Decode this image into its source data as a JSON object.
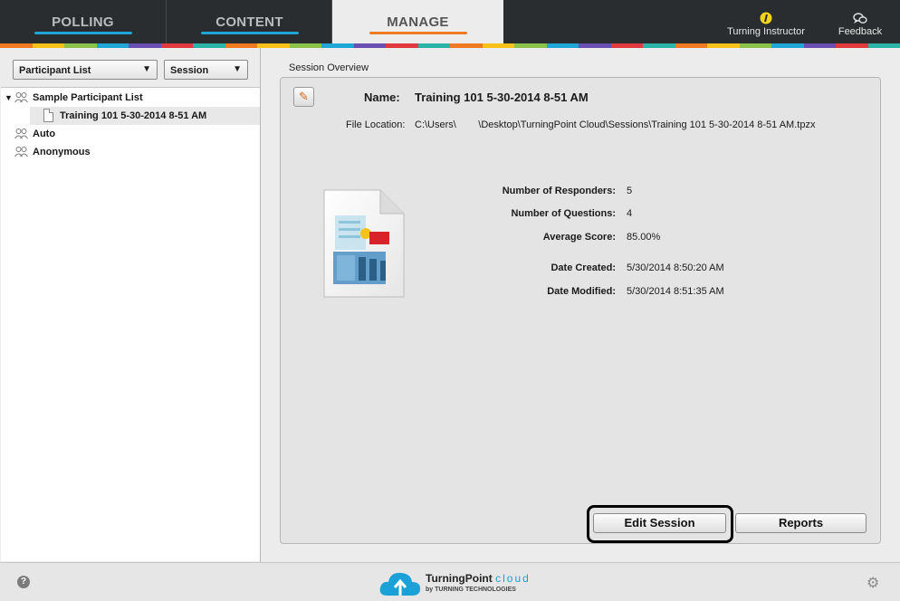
{
  "nav": {
    "tabs": [
      {
        "label": "POLLING",
        "underline_color": "#1ea7d6"
      },
      {
        "label": "CONTENT",
        "underline_color": "#1ea7d6"
      },
      {
        "label": "MANAGE",
        "underline_color": "#f07a21"
      }
    ],
    "turning_instructor": "Turning Instructor",
    "feedback": "Feedback",
    "stripe_colors": [
      "#f07a21",
      "#f5c21b",
      "#8bc34a",
      "#1ea7d6",
      "#6a4fb3",
      "#e03a3e",
      "#2ab3a6"
    ]
  },
  "left": {
    "participant_dropdown": "Participant List",
    "session_dropdown": "Session",
    "tree": [
      {
        "label": "Sample Participant List",
        "icon": "group-icon"
      },
      {
        "label": "Training 101 5-30-2014 8-51 AM",
        "icon": "file-icon"
      },
      {
        "label": "Auto",
        "icon": "group-icon"
      },
      {
        "label": "Anonymous",
        "icon": "group-icon"
      }
    ]
  },
  "overview": {
    "section_label": "Session Overview",
    "name_label": "Name:",
    "name_value": "Training 101 5-30-2014 8-51 AM",
    "location_label": "File Location:",
    "location_value": "C:\\Users\\        \\Desktop\\TurningPoint Cloud\\Sessions\\Training 101 5-30-2014 8-51 AM.tpzx",
    "stats": [
      {
        "label": "Number of Responders:",
        "value": "5"
      },
      {
        "label": "Number of Questions:",
        "value": "4"
      },
      {
        "label": "Average Score:",
        "value": "85.00%"
      },
      {
        "label": "Date Created:",
        "value": "5/30/2014 8:50:20 AM"
      },
      {
        "label": "Date Modified:",
        "value": "5/30/2014 8:51:35 AM"
      }
    ],
    "edit_button": "Edit Session",
    "reports_button": "Reports"
  },
  "footer": {
    "help": "?",
    "brand_name": "TurningPoint",
    "brand_cloud": "cloud",
    "brand_by": "by  TURNING TECHNOLOGIES"
  }
}
